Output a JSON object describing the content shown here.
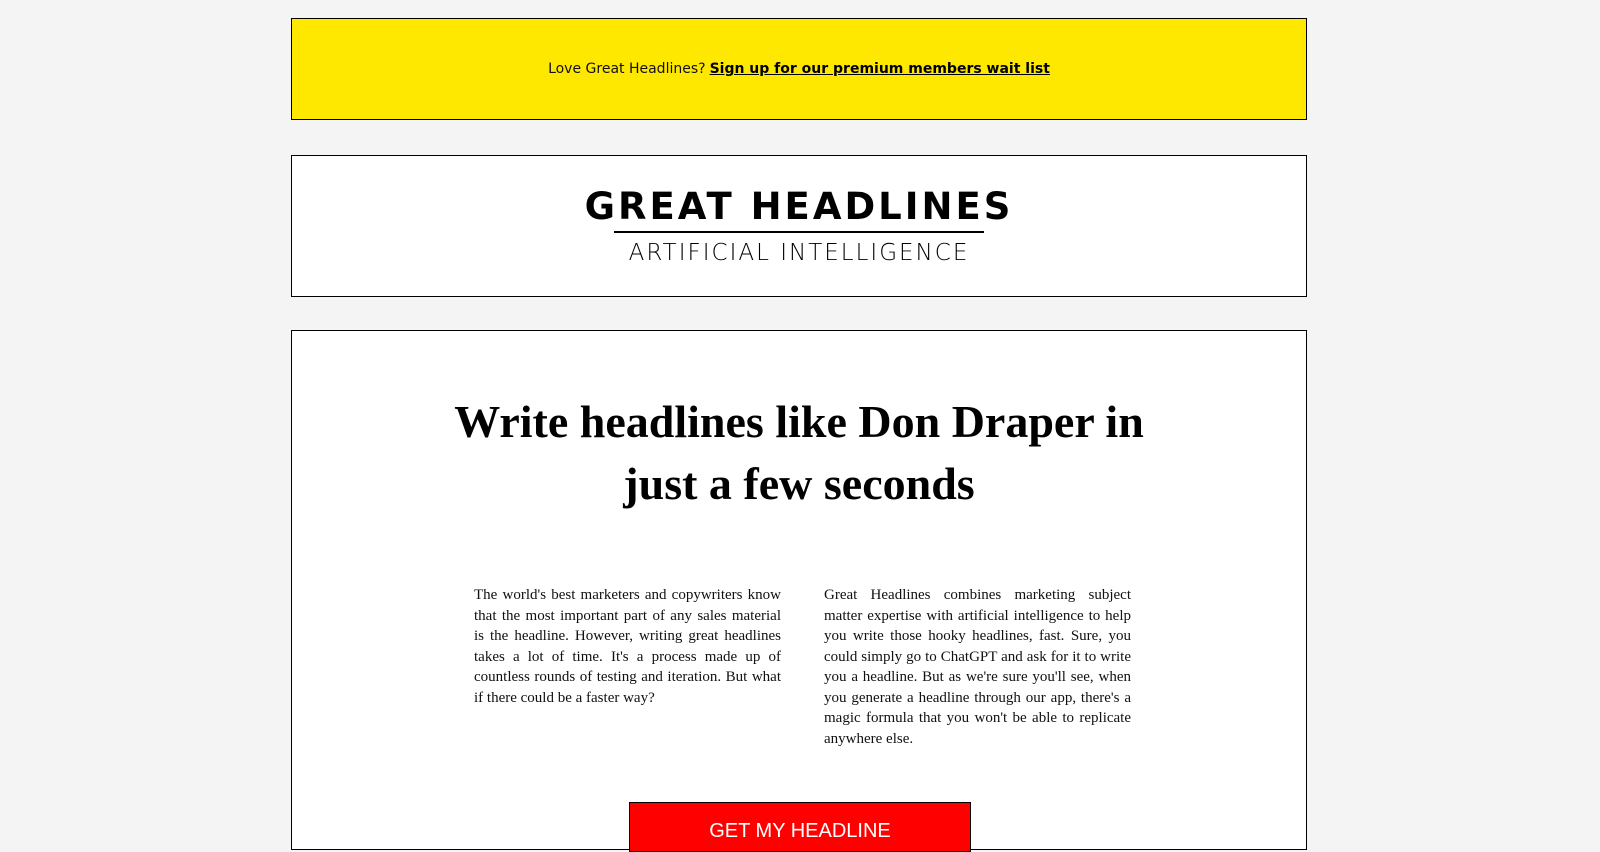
{
  "banner": {
    "lead_text": "Love Great Headlines?",
    "link_text": "Sign up for our premium members wait list"
  },
  "logo": {
    "title": "GREAT HEADLINES",
    "subtitle": "ARTIFICIAL INTELLIGENCE"
  },
  "hero": {
    "title_line1": "Write headlines like Don Draper in",
    "title_line2": "just a few seconds"
  },
  "columns": {
    "left": "The world's best marketers and copywriters know that the most important part of any sales material is the headline. However, writing great headlines takes a lot of time. It's a process made up of countless rounds of testing and iteration. But what if there could be a faster way?",
    "right": "Great Headlines combines marketing subject matter expertise with artificial intelligence to help you write those hooky headlines, fast. Sure, you could simply go to ChatGPT and ask for it to write you a headline. But as we're sure you'll see, when you generate a headline through our app, there's a magic formula that you won't be able to replicate anywhere else."
  },
  "cta": {
    "label": "GET MY HEADLINE"
  },
  "colors": {
    "page_background": "#f4f4f4",
    "banner_background": "#ffe800",
    "cta_background": "#ff0000",
    "cta_text": "#ffffff"
  }
}
